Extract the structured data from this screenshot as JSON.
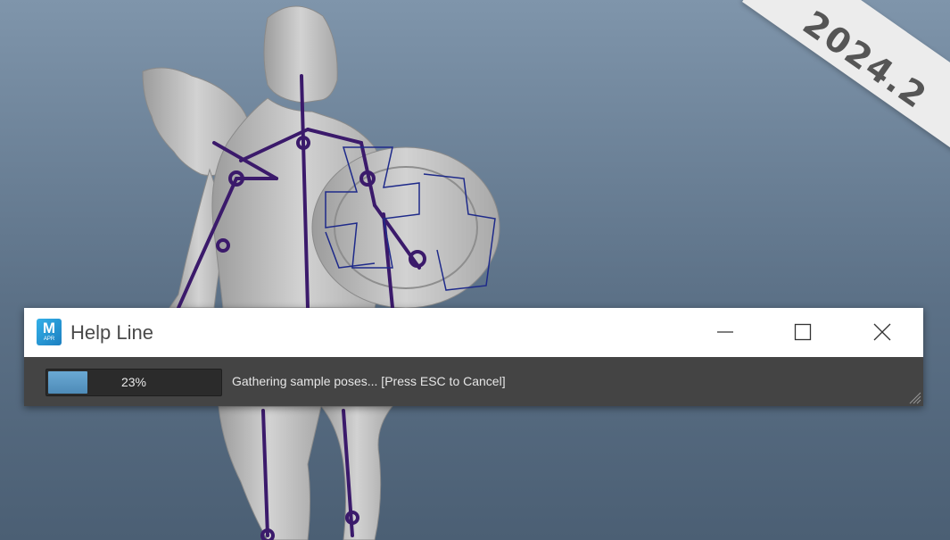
{
  "version_banner": {
    "text": "2024.2"
  },
  "help_line_window": {
    "title": "Help Line",
    "app_icon": {
      "name": "maya-app-icon",
      "letter": "M",
      "sublabel": "APR"
    },
    "controls": {
      "minimize_icon": "minimize-icon",
      "maximize_icon": "maximize-icon",
      "close_icon": "close-icon"
    },
    "progress": {
      "percent": 23,
      "label": "23%"
    },
    "status_message": "Gathering sample poses... [Press ESC to Cancel]"
  },
  "colors": {
    "viewport_top": "#7f95ab",
    "viewport_bottom": "#4b5f74",
    "rig_joint": "#3b1a6b",
    "rig_control": "#1e2a8a",
    "mesh": "#c9c9c9",
    "statusbar_bg": "#444444",
    "progress_fill": "#5a99c8"
  }
}
